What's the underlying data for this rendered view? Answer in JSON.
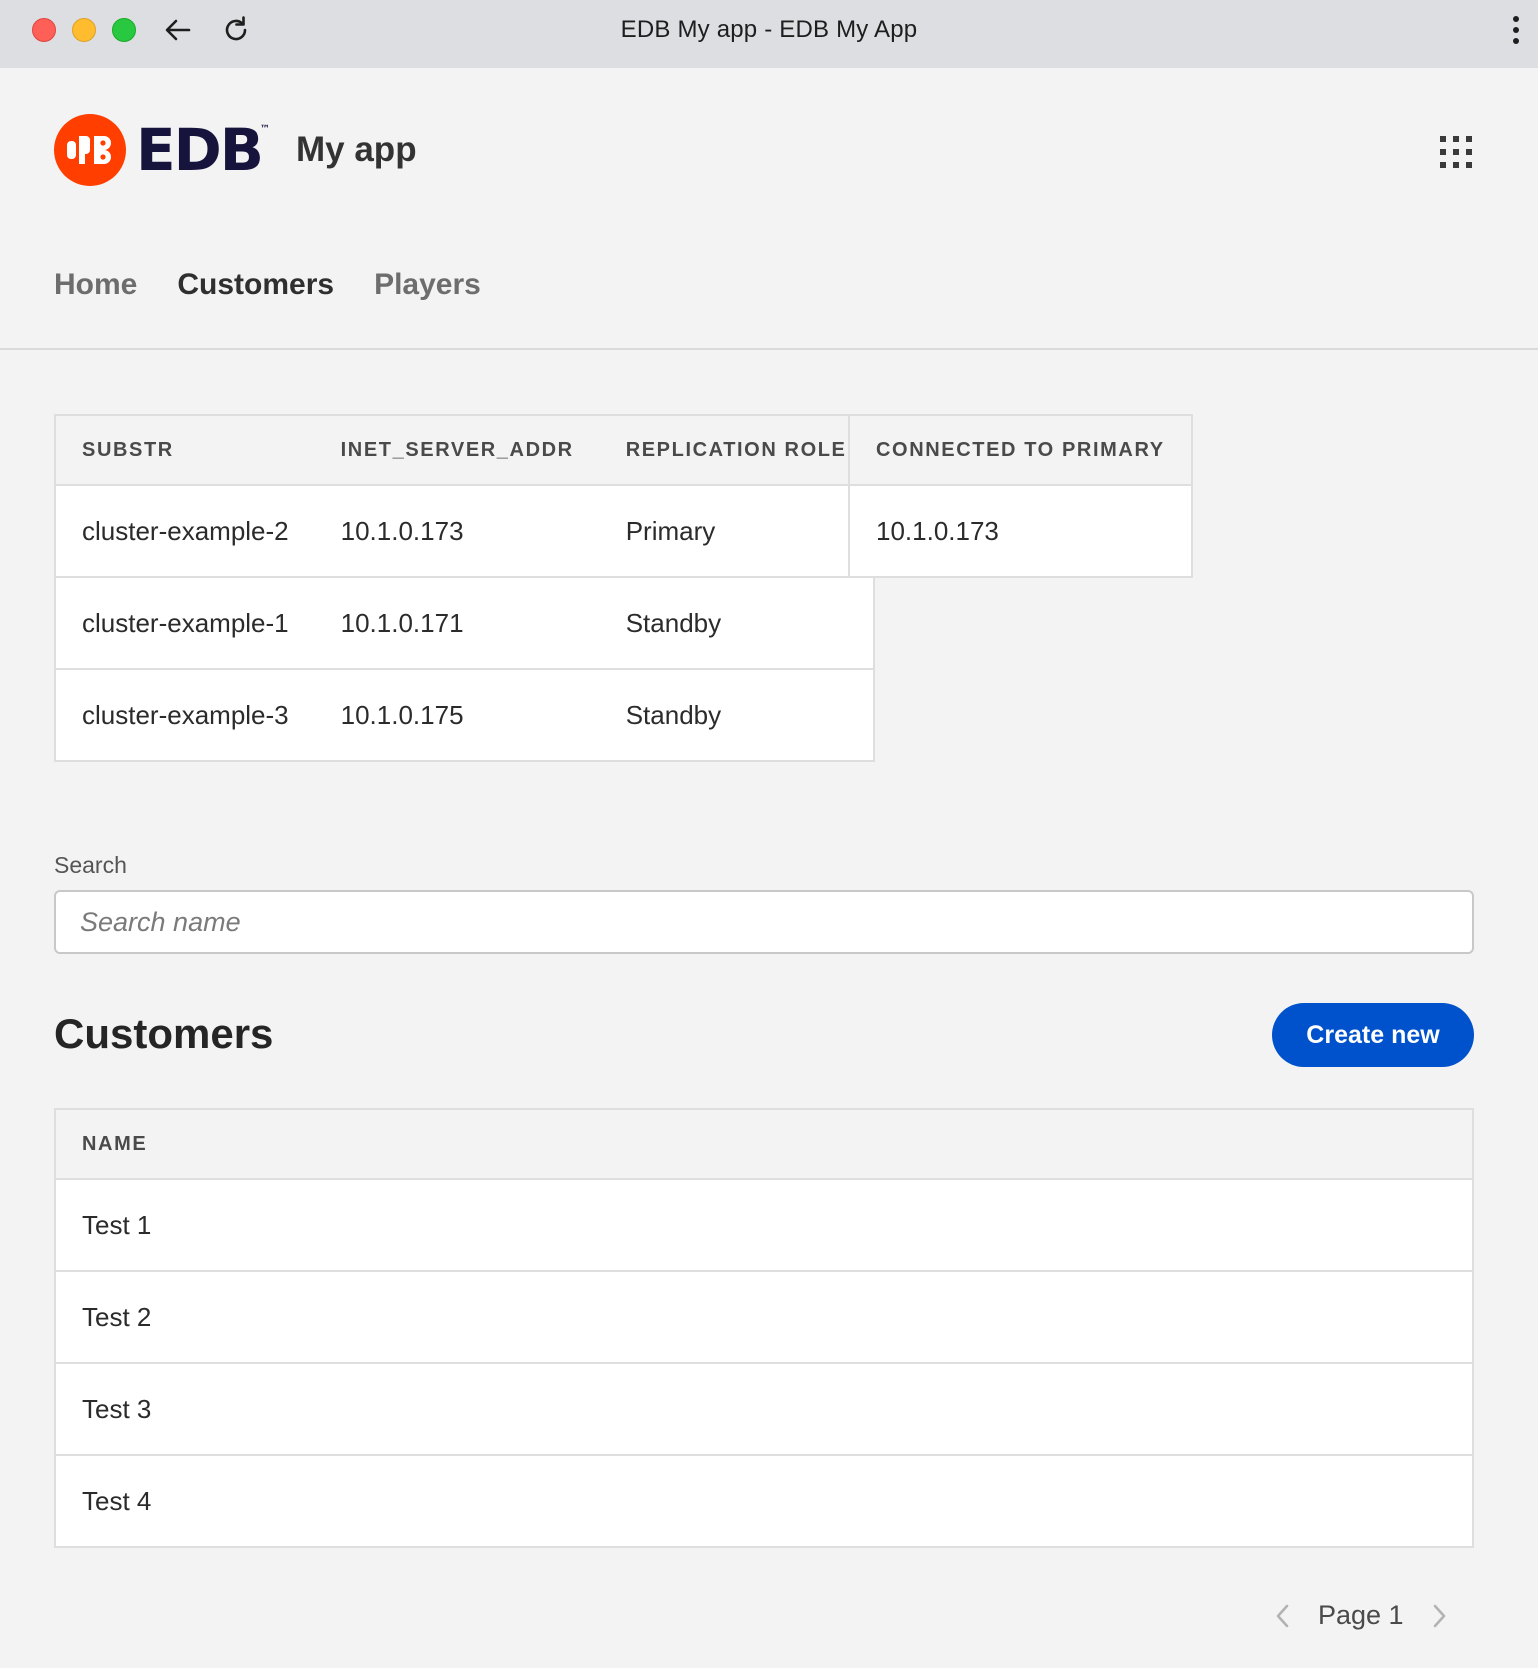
{
  "browser": {
    "title": "EDB My app - EDB My App"
  },
  "header": {
    "logo_text": "EDB",
    "logo_tm": "™",
    "app_name": "My app"
  },
  "tabs": [
    {
      "label": "Home",
      "active": false
    },
    {
      "label": "Customers",
      "active": true
    },
    {
      "label": "Players",
      "active": false
    }
  ],
  "replication_table": {
    "headers": [
      "SUBSTR",
      "INET_SERVER_ADDR",
      "REPLICATION ROLE"
    ],
    "rows": [
      [
        "cluster-example-2",
        "10.1.0.173",
        "Primary"
      ],
      [
        "cluster-example-1",
        "10.1.0.171",
        "Standby"
      ],
      [
        "cluster-example-3",
        "10.1.0.175",
        "Standby"
      ]
    ]
  },
  "primary_table": {
    "header": "CONNECTED TO PRIMARY",
    "value": "10.1.0.173"
  },
  "search": {
    "label": "Search",
    "placeholder": "Search name",
    "value": ""
  },
  "customers": {
    "title": "Customers",
    "create_label": "Create new",
    "header": "NAME",
    "rows": [
      "Test 1",
      "Test 2",
      "Test 3",
      "Test 4"
    ]
  },
  "pagination": {
    "label": "Page 1"
  },
  "colors": {
    "brand": "#ff3e00",
    "logo_text": "#16133d",
    "primary_button": "#0052cc",
    "background": "#f3f3f3"
  },
  "icons": [
    "back-arrow-icon",
    "reload-icon",
    "kebab-menu-icon",
    "apps-grid-icon",
    "chevron-left-icon",
    "chevron-right-icon"
  ]
}
